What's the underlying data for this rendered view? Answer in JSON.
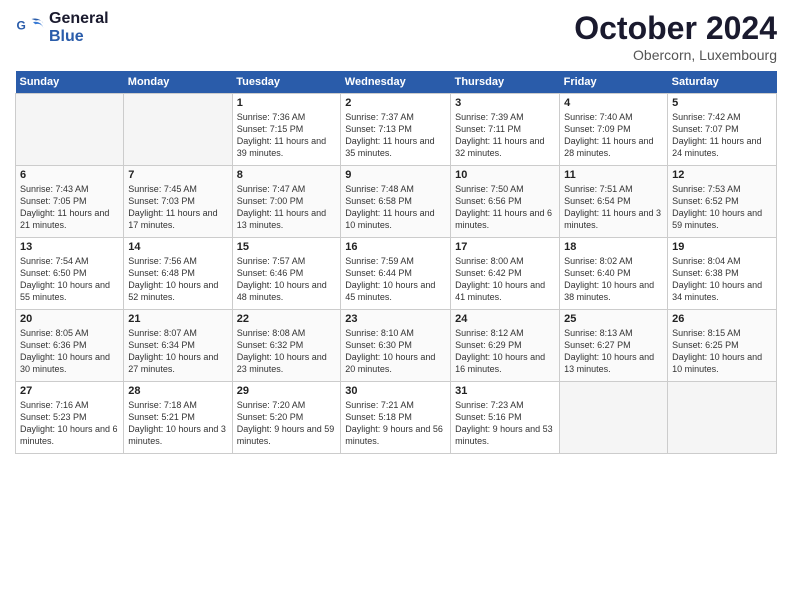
{
  "header": {
    "logo_line1": "General",
    "logo_line2": "Blue",
    "month": "October 2024",
    "location": "Obercorn, Luxembourg"
  },
  "weekdays": [
    "Sunday",
    "Monday",
    "Tuesday",
    "Wednesday",
    "Thursday",
    "Friday",
    "Saturday"
  ],
  "weeks": [
    [
      {
        "day": "",
        "sunrise": "",
        "sunset": "",
        "daylight": ""
      },
      {
        "day": "",
        "sunrise": "",
        "sunset": "",
        "daylight": ""
      },
      {
        "day": "1",
        "sunrise": "Sunrise: 7:36 AM",
        "sunset": "Sunset: 7:15 PM",
        "daylight": "Daylight: 11 hours and 39 minutes."
      },
      {
        "day": "2",
        "sunrise": "Sunrise: 7:37 AM",
        "sunset": "Sunset: 7:13 PM",
        "daylight": "Daylight: 11 hours and 35 minutes."
      },
      {
        "day": "3",
        "sunrise": "Sunrise: 7:39 AM",
        "sunset": "Sunset: 7:11 PM",
        "daylight": "Daylight: 11 hours and 32 minutes."
      },
      {
        "day": "4",
        "sunrise": "Sunrise: 7:40 AM",
        "sunset": "Sunset: 7:09 PM",
        "daylight": "Daylight: 11 hours and 28 minutes."
      },
      {
        "day": "5",
        "sunrise": "Sunrise: 7:42 AM",
        "sunset": "Sunset: 7:07 PM",
        "daylight": "Daylight: 11 hours and 24 minutes."
      }
    ],
    [
      {
        "day": "6",
        "sunrise": "Sunrise: 7:43 AM",
        "sunset": "Sunset: 7:05 PM",
        "daylight": "Daylight: 11 hours and 21 minutes."
      },
      {
        "day": "7",
        "sunrise": "Sunrise: 7:45 AM",
        "sunset": "Sunset: 7:03 PM",
        "daylight": "Daylight: 11 hours and 17 minutes."
      },
      {
        "day": "8",
        "sunrise": "Sunrise: 7:47 AM",
        "sunset": "Sunset: 7:00 PM",
        "daylight": "Daylight: 11 hours and 13 minutes."
      },
      {
        "day": "9",
        "sunrise": "Sunrise: 7:48 AM",
        "sunset": "Sunset: 6:58 PM",
        "daylight": "Daylight: 11 hours and 10 minutes."
      },
      {
        "day": "10",
        "sunrise": "Sunrise: 7:50 AM",
        "sunset": "Sunset: 6:56 PM",
        "daylight": "Daylight: 11 hours and 6 minutes."
      },
      {
        "day": "11",
        "sunrise": "Sunrise: 7:51 AM",
        "sunset": "Sunset: 6:54 PM",
        "daylight": "Daylight: 11 hours and 3 minutes."
      },
      {
        "day": "12",
        "sunrise": "Sunrise: 7:53 AM",
        "sunset": "Sunset: 6:52 PM",
        "daylight": "Daylight: 10 hours and 59 minutes."
      }
    ],
    [
      {
        "day": "13",
        "sunrise": "Sunrise: 7:54 AM",
        "sunset": "Sunset: 6:50 PM",
        "daylight": "Daylight: 10 hours and 55 minutes."
      },
      {
        "day": "14",
        "sunrise": "Sunrise: 7:56 AM",
        "sunset": "Sunset: 6:48 PM",
        "daylight": "Daylight: 10 hours and 52 minutes."
      },
      {
        "day": "15",
        "sunrise": "Sunrise: 7:57 AM",
        "sunset": "Sunset: 6:46 PM",
        "daylight": "Daylight: 10 hours and 48 minutes."
      },
      {
        "day": "16",
        "sunrise": "Sunrise: 7:59 AM",
        "sunset": "Sunset: 6:44 PM",
        "daylight": "Daylight: 10 hours and 45 minutes."
      },
      {
        "day": "17",
        "sunrise": "Sunrise: 8:00 AM",
        "sunset": "Sunset: 6:42 PM",
        "daylight": "Daylight: 10 hours and 41 minutes."
      },
      {
        "day": "18",
        "sunrise": "Sunrise: 8:02 AM",
        "sunset": "Sunset: 6:40 PM",
        "daylight": "Daylight: 10 hours and 38 minutes."
      },
      {
        "day": "19",
        "sunrise": "Sunrise: 8:04 AM",
        "sunset": "Sunset: 6:38 PM",
        "daylight": "Daylight: 10 hours and 34 minutes."
      }
    ],
    [
      {
        "day": "20",
        "sunrise": "Sunrise: 8:05 AM",
        "sunset": "Sunset: 6:36 PM",
        "daylight": "Daylight: 10 hours and 30 minutes."
      },
      {
        "day": "21",
        "sunrise": "Sunrise: 8:07 AM",
        "sunset": "Sunset: 6:34 PM",
        "daylight": "Daylight: 10 hours and 27 minutes."
      },
      {
        "day": "22",
        "sunrise": "Sunrise: 8:08 AM",
        "sunset": "Sunset: 6:32 PM",
        "daylight": "Daylight: 10 hours and 23 minutes."
      },
      {
        "day": "23",
        "sunrise": "Sunrise: 8:10 AM",
        "sunset": "Sunset: 6:30 PM",
        "daylight": "Daylight: 10 hours and 20 minutes."
      },
      {
        "day": "24",
        "sunrise": "Sunrise: 8:12 AM",
        "sunset": "Sunset: 6:29 PM",
        "daylight": "Daylight: 10 hours and 16 minutes."
      },
      {
        "day": "25",
        "sunrise": "Sunrise: 8:13 AM",
        "sunset": "Sunset: 6:27 PM",
        "daylight": "Daylight: 10 hours and 13 minutes."
      },
      {
        "day": "26",
        "sunrise": "Sunrise: 8:15 AM",
        "sunset": "Sunset: 6:25 PM",
        "daylight": "Daylight: 10 hours and 10 minutes."
      }
    ],
    [
      {
        "day": "27",
        "sunrise": "Sunrise: 7:16 AM",
        "sunset": "Sunset: 5:23 PM",
        "daylight": "Daylight: 10 hours and 6 minutes."
      },
      {
        "day": "28",
        "sunrise": "Sunrise: 7:18 AM",
        "sunset": "Sunset: 5:21 PM",
        "daylight": "Daylight: 10 hours and 3 minutes."
      },
      {
        "day": "29",
        "sunrise": "Sunrise: 7:20 AM",
        "sunset": "Sunset: 5:20 PM",
        "daylight": "Daylight: 9 hours and 59 minutes."
      },
      {
        "day": "30",
        "sunrise": "Sunrise: 7:21 AM",
        "sunset": "Sunset: 5:18 PM",
        "daylight": "Daylight: 9 hours and 56 minutes."
      },
      {
        "day": "31",
        "sunrise": "Sunrise: 7:23 AM",
        "sunset": "Sunset: 5:16 PM",
        "daylight": "Daylight: 9 hours and 53 minutes."
      },
      {
        "day": "",
        "sunrise": "",
        "sunset": "",
        "daylight": ""
      },
      {
        "day": "",
        "sunrise": "",
        "sunset": "",
        "daylight": ""
      }
    ]
  ]
}
